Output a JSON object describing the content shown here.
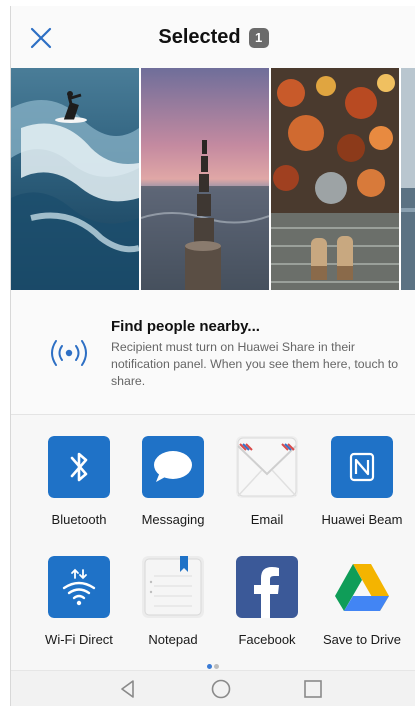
{
  "header": {
    "title": "Selected",
    "selected_count": "1",
    "close_icon": "close-icon"
  },
  "photos": [
    {
      "name": "surfer-wave-photo"
    },
    {
      "name": "sunset-pier-photo"
    },
    {
      "name": "autumn-leaves-feet-photo"
    },
    {
      "name": "sea-partial-photo"
    }
  ],
  "nearby": {
    "title": "Find people nearby...",
    "description": "Recipient must turn on Huawei Share in their notification panel. When you see them here, touch to share.",
    "icon": "wireless-signal-icon"
  },
  "share_apps": [
    {
      "label": "Bluetooth",
      "icon": "bluetooth-icon"
    },
    {
      "label": "Messaging",
      "icon": "messaging-icon"
    },
    {
      "label": "Email",
      "icon": "email-icon"
    },
    {
      "label": "Huawei Beam",
      "icon": "nfc-icon"
    },
    {
      "label": "Wi-Fi Direct",
      "icon": "wifi-direct-icon"
    },
    {
      "label": "Notepad",
      "icon": "notepad-icon"
    },
    {
      "label": "Facebook",
      "icon": "facebook-icon"
    },
    {
      "label": "Save to Drive",
      "icon": "google-drive-icon"
    }
  ],
  "pager": {
    "pages": 2,
    "current": 1
  },
  "navbar": {
    "back_icon": "back-triangle-icon",
    "home_icon": "home-circle-icon",
    "recents_icon": "recents-square-icon"
  },
  "colors": {
    "accent": "#3a7bd5",
    "app_blue": "#1f72c7"
  }
}
